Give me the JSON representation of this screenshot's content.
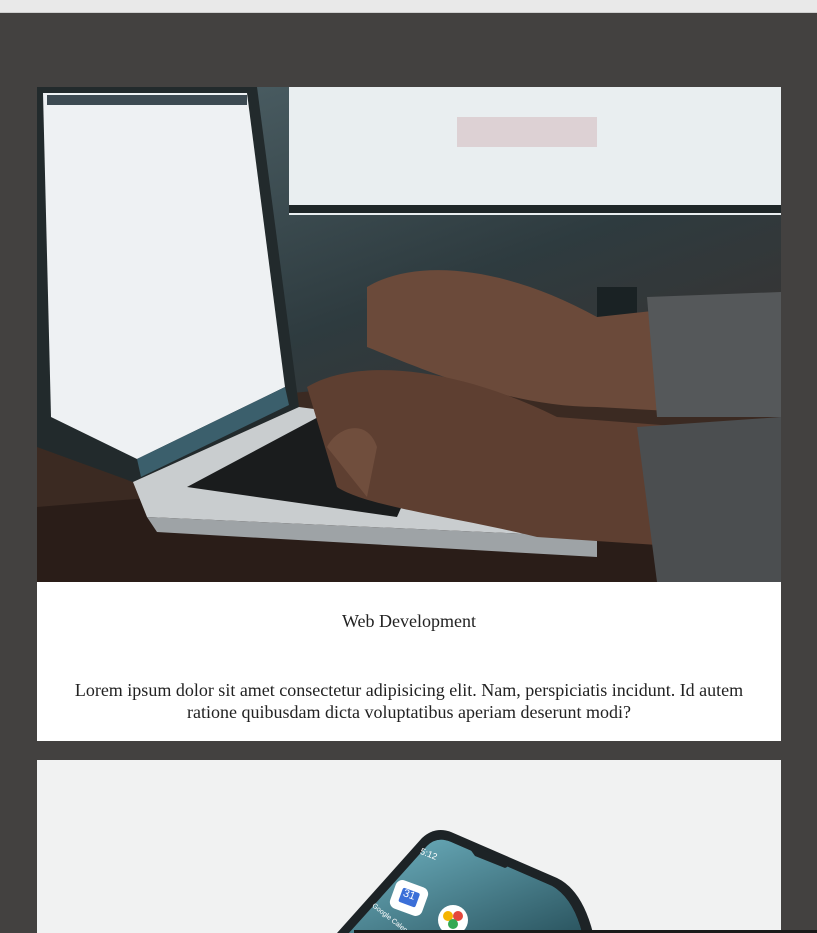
{
  "cards": [
    {
      "image_alt": "Hands typing on a laptop keyboard",
      "title": "Web Development",
      "text": "Lorem ipsum dolor sit amet consectetur adipisicing elit. Nam, perspiciatis incidunt. Id autem ratione quibusdam dicta voluptatibus aperiam deserunt modi?"
    },
    {
      "image_alt": "Smartphone with app icons on a white desk",
      "phone_calendar_day": "31",
      "phone_calendar_app": "Google Calendar",
      "phone_time": "5:12"
    }
  ]
}
